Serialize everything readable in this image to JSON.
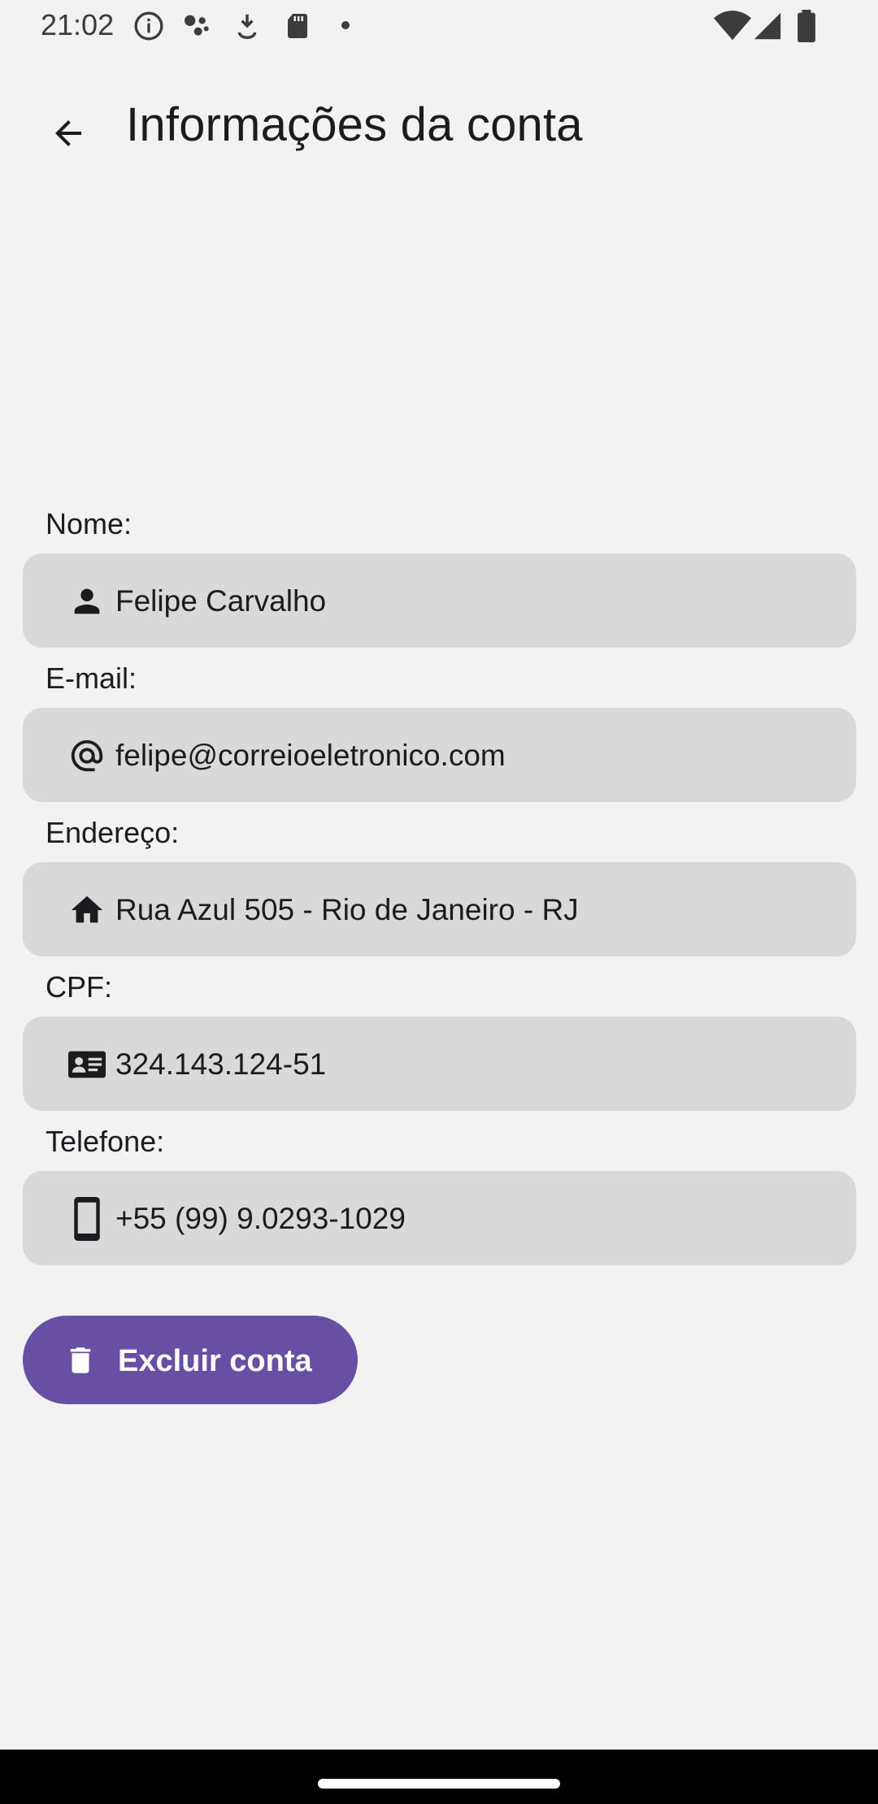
{
  "status_bar": {
    "time": "21:02",
    "icons_left": [
      "info-icon",
      "notification-dots-icon",
      "download-icon",
      "sd-card-icon",
      "dot-icon"
    ],
    "icons_right": [
      "wifi-icon",
      "cell-signal-icon",
      "battery-icon"
    ]
  },
  "app_bar": {
    "title": "Informações da conta",
    "back_icon": "arrow-back-icon"
  },
  "form": {
    "fields": [
      {
        "label": "Nome:",
        "value": "Felipe Carvalho",
        "icon": "person-icon"
      },
      {
        "label": "E-mail:",
        "value": "felipe@correioeletronico.com",
        "icon": "at-sign-icon"
      },
      {
        "label": "Endereço:",
        "value": "Rua Azul 505 - Rio de Janeiro - RJ",
        "icon": "home-icon"
      },
      {
        "label": "CPF:",
        "value": "324.143.124-51",
        "icon": "id-card-icon"
      },
      {
        "label": "Telefone:",
        "value": "+55 (99) 9.0293-1029",
        "icon": "phone-icon"
      }
    ]
  },
  "delete_button": {
    "label": "Excluir conta",
    "icon": "trash-icon"
  },
  "colors": {
    "background": "#f2f2f2",
    "field_background": "#d9d9d9",
    "accent": "#6750a4",
    "text": "#1c1b1f"
  }
}
